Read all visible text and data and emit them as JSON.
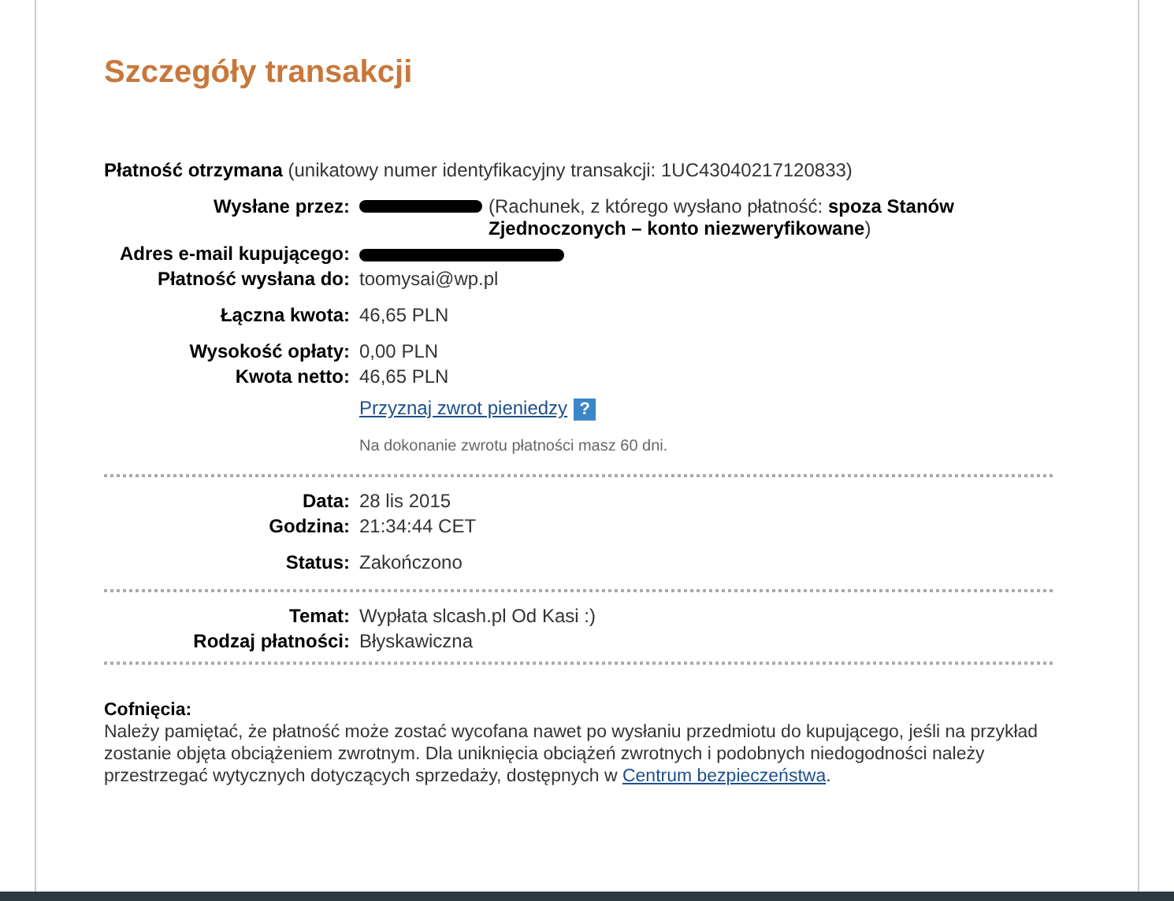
{
  "title": "Szczegóły transakcji",
  "summary": {
    "status": "Płatność otrzymana",
    "detail": "(unikatowy numer identyfikacyjny transakcji: 1UC43040217120833)"
  },
  "sections": [
    {
      "groups": [
        [
          {
            "kind": "sender",
            "label": "Wysłane przez:",
            "note": "(Rachunek, z którego wysłano płatność: **spoza Stanów Zjednoczonych – konto niezweryfikowane**)"
          },
          {
            "kind": "redacted",
            "label": "Adres e-mail kupującego:"
          },
          {
            "kind": "text",
            "label": "Płatność wysłana do:",
            "value": "toomysai@wp.pl"
          }
        ],
        [
          {
            "kind": "text",
            "label": "Łączna kwota:",
            "value": "46,65 PLN"
          }
        ],
        [
          {
            "kind": "text",
            "label": "Wysokość opłaty:",
            "value": "0,00 PLN"
          },
          {
            "kind": "text",
            "label": "Kwota netto:",
            "value": "46,65 PLN"
          },
          {
            "kind": "refund",
            "link": "Przyznaj zwrot pieniedzy",
            "help": "?",
            "hint": "Na dokonanie zwrotu płatności masz 60 dni."
          }
        ]
      ]
    },
    {
      "groups": [
        [
          {
            "kind": "text",
            "label": "Data:",
            "value": "28 lis 2015"
          },
          {
            "kind": "text",
            "label": "Godzina:",
            "value": "21:34:44 CET"
          }
        ],
        [
          {
            "kind": "text",
            "label": "Status:",
            "value": "Zakończono"
          }
        ]
      ]
    },
    {
      "groups": [
        [
          {
            "kind": "text",
            "label": "Temat:",
            "value": "Wypłata slcash.pl Od Kasi :)"
          },
          {
            "kind": "text",
            "label": "Rodzaj płatności:",
            "value": "Błyskawiczna"
          }
        ]
      ]
    }
  ],
  "notice": {
    "heading": "Cofnięcia:",
    "text": "Należy pamiętać, że płatność może zostać wycofana nawet po wysłaniu przedmiotu do kupującego, jeśli na przykład zostanie objęta obciążeniem zwrotnym. Dla uniknięcia obciążeń zwrotnych i podobnych niedogodności należy przestrzegać wytycznych dotyczących sprzedaży, dostępnych w",
    "link": "Centrum bezpieczeństwa",
    "end": "."
  }
}
